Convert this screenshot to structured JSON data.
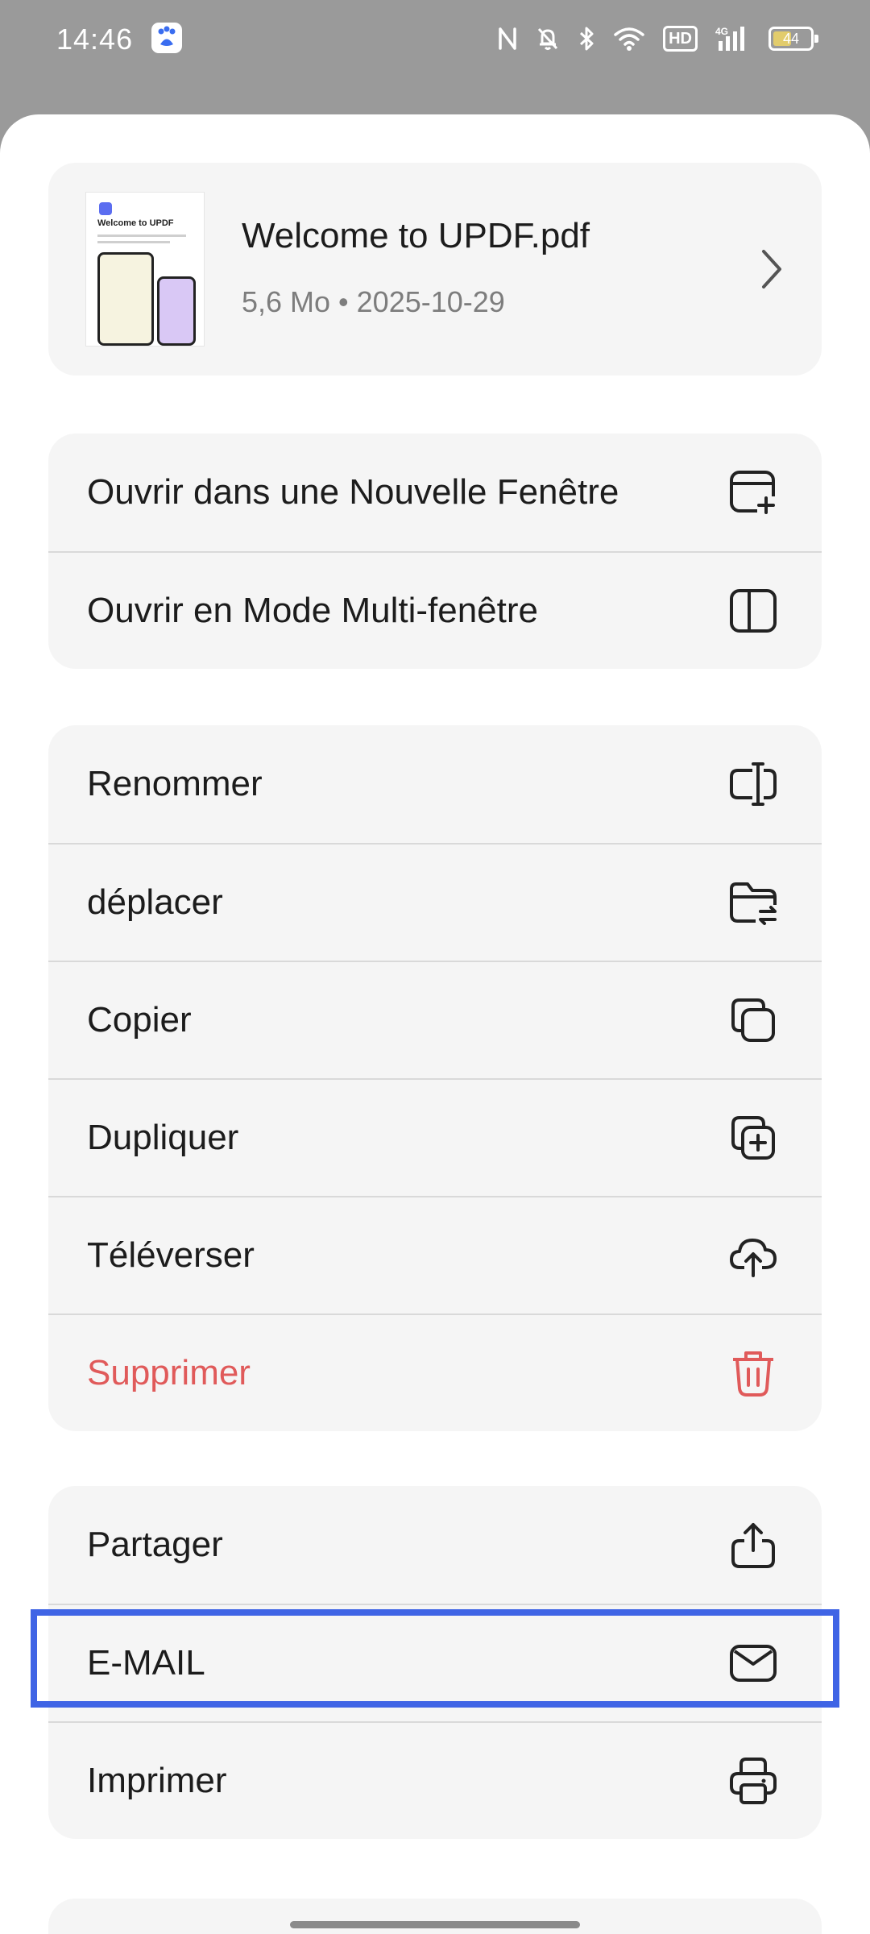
{
  "status_bar": {
    "time": "14:46",
    "app_icon": "baidu-icon",
    "indicators": [
      "nfc-icon",
      "mute-bell-icon",
      "bluetooth-icon",
      "wifi-icon",
      "hd-badge",
      "signal-4g-icon"
    ],
    "hd_label": "HD",
    "network": "4G",
    "battery_level": "44",
    "battery_fraction": 0.44
  },
  "file": {
    "name": "Welcome to UPDF.pdf",
    "meta": "5,6 Mo • 2025-10-29",
    "thumbnail_title": "Welcome to UPDF"
  },
  "groups": [
    {
      "items": [
        {
          "label": "Ouvrir dans une Nouvelle Fenêtre",
          "icon": "new-window-icon"
        },
        {
          "label": "Ouvrir en Mode Multi-fenêtre",
          "icon": "split-view-icon"
        }
      ]
    },
    {
      "items": [
        {
          "label": "Renommer",
          "icon": "rename-icon"
        },
        {
          "label": "déplacer",
          "icon": "move-folder-icon"
        },
        {
          "label": "Copier",
          "icon": "copy-icon"
        },
        {
          "label": "Dupliquer",
          "icon": "duplicate-icon"
        },
        {
          "label": "Téléverser",
          "icon": "cloud-upload-icon"
        },
        {
          "label": "Supprimer",
          "icon": "trash-icon",
          "color": "#e05a5a"
        }
      ]
    },
    {
      "items": [
        {
          "label": "Partager",
          "icon": "share-icon"
        },
        {
          "label": "E-MAIL",
          "icon": "mail-icon",
          "highlighted": true
        },
        {
          "label": "Imprimer",
          "icon": "printer-icon"
        }
      ]
    }
  ],
  "colors": {
    "danger": "#e05a5a",
    "highlight": "#3f64e5",
    "card_bg": "#f5f5f5"
  }
}
